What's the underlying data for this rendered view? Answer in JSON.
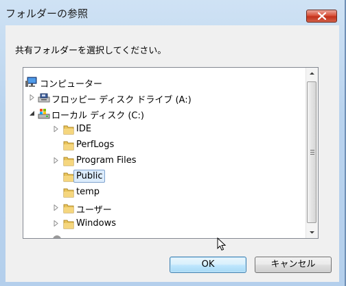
{
  "window": {
    "title": "フォルダーの参照",
    "instruction": "共有フォルダーを選択してください。"
  },
  "tree": {
    "items": [
      {
        "label": "コンピューター",
        "icon": "computer-icon",
        "expander": "none"
      },
      {
        "label": "フロッピー ディスク ドライブ (A:)",
        "icon": "floppy-drive-icon",
        "expander": "collapsed"
      },
      {
        "label": "ローカル ディスク (C:)",
        "icon": "local-disk-icon",
        "expander": "expanded"
      },
      {
        "label": "IDE",
        "icon": "folder-icon",
        "expander": "collapsed"
      },
      {
        "label": "PerfLogs",
        "icon": "folder-icon",
        "expander": "none"
      },
      {
        "label": "Program Files",
        "icon": "folder-icon",
        "expander": "collapsed"
      },
      {
        "label": "Public",
        "icon": "folder-icon",
        "expander": "none",
        "selected": true
      },
      {
        "label": "temp",
        "icon": "folder-icon",
        "expander": "none"
      },
      {
        "label": "ユーザー",
        "icon": "folder-icon",
        "expander": "collapsed"
      },
      {
        "label": "Windows",
        "icon": "folder-icon",
        "expander": "collapsed"
      }
    ]
  },
  "buttons": {
    "ok": "OK",
    "cancel": "キャンセル"
  },
  "colors": {
    "selection_bg": "#dcecfc",
    "selection_border": "#7da2ce",
    "folder": "#e8c35a",
    "close_button": "#c3311b"
  }
}
